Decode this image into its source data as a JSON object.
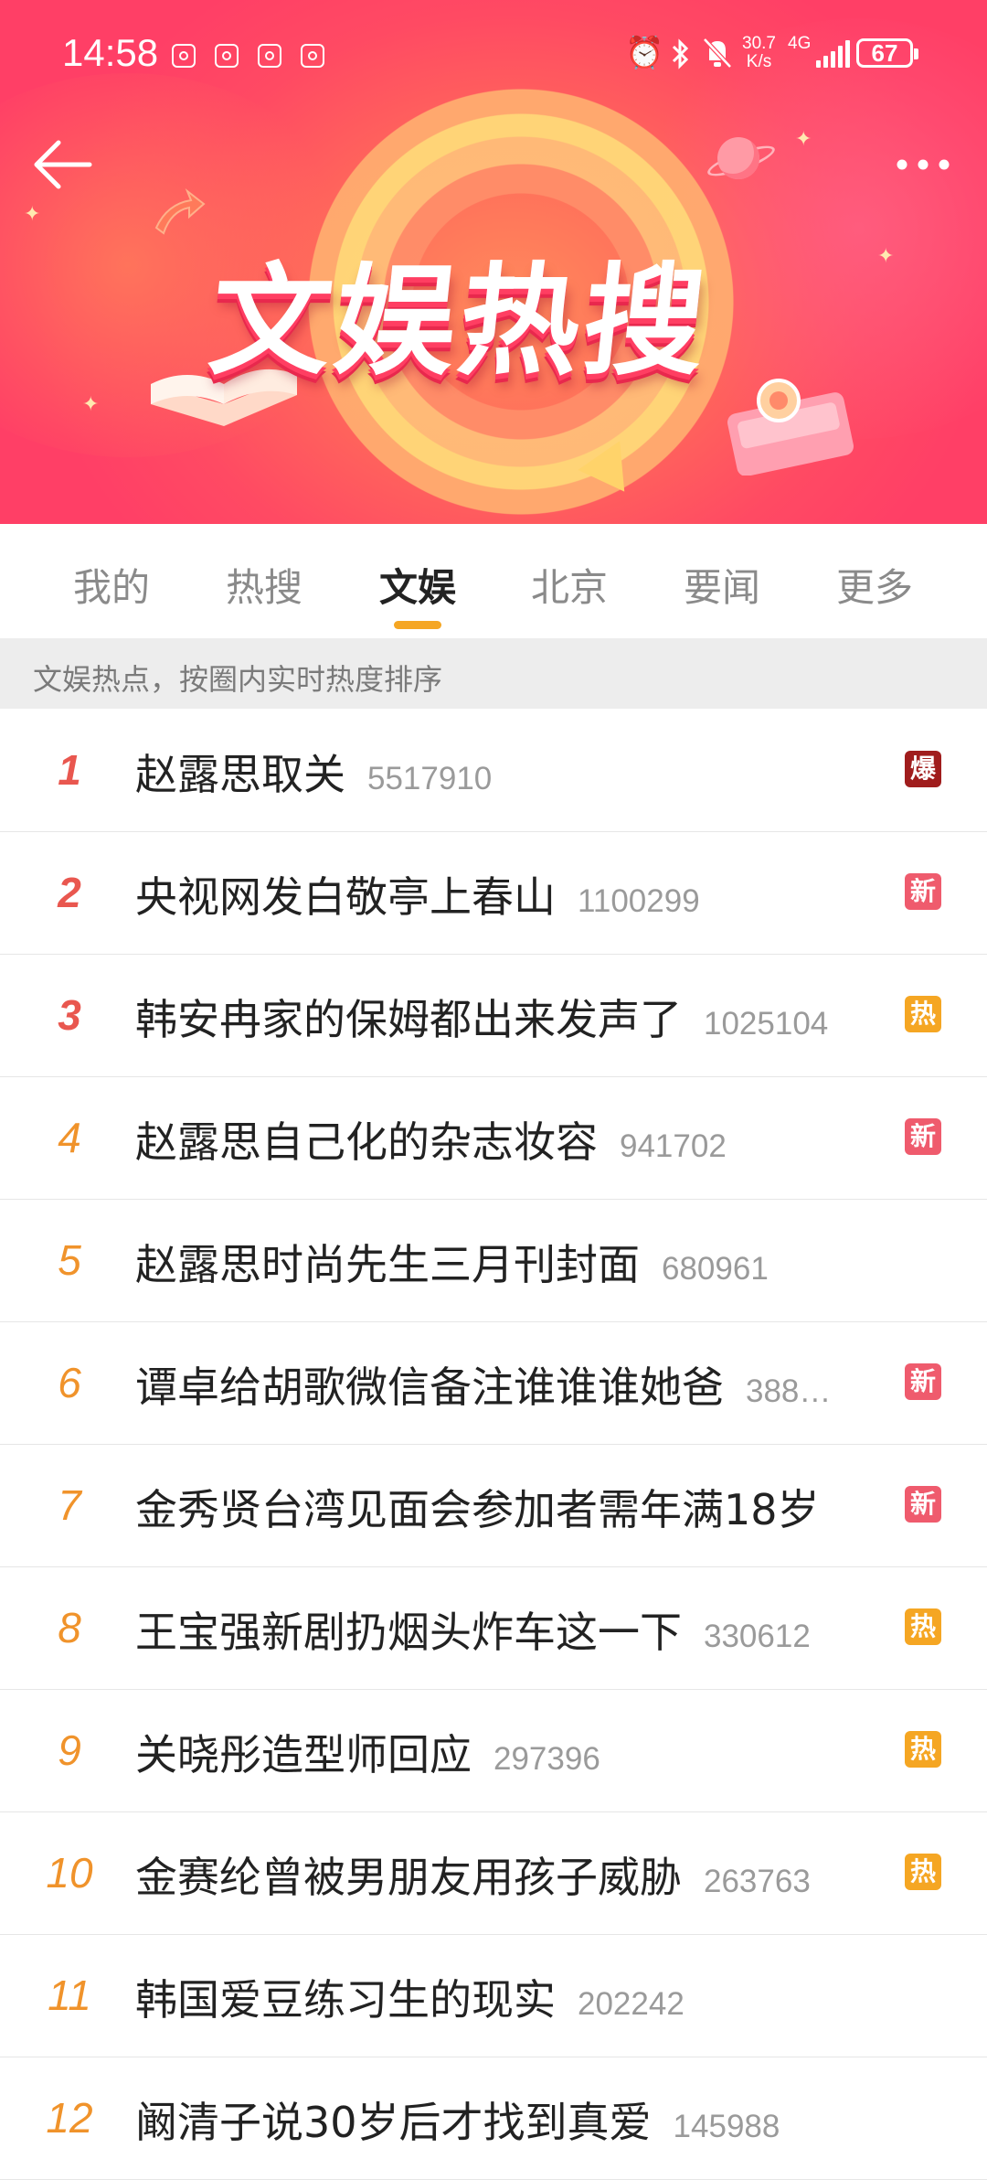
{
  "status_bar": {
    "time": "14:58",
    "net_speed_value": "30.7",
    "net_speed_unit": "K/s",
    "network_type": "4G",
    "battery": "67"
  },
  "banner": {
    "title": "文娱热搜"
  },
  "tabs": [
    {
      "label": "我的",
      "active": false
    },
    {
      "label": "热搜",
      "active": false
    },
    {
      "label": "文娱",
      "active": true
    },
    {
      "label": "北京",
      "active": false
    },
    {
      "label": "要闻",
      "active": false
    },
    {
      "label": "更多",
      "active": false
    }
  ],
  "subtitle": "文娱热点，按圈内实时热度排序",
  "colors": {
    "accent": "#f5a623",
    "rank_top": "#e9574f",
    "rank_other": "#f0932b",
    "badge_bao": "#a01d1d",
    "badge_xin": "#ef5b6d",
    "badge_re": "#f5a623"
  },
  "list": [
    {
      "rank": "1",
      "title": "赵露思取关",
      "count": "5517910",
      "badge": "爆"
    },
    {
      "rank": "2",
      "title": "央视网发白敬亭上春山",
      "count": "1100299",
      "badge": "新"
    },
    {
      "rank": "3",
      "title": "韩安冉家的保姆都出来发声了",
      "count": "1025104",
      "badge": "热"
    },
    {
      "rank": "4",
      "title": "赵露思自己化的杂志妆容",
      "count": "941702",
      "badge": "新"
    },
    {
      "rank": "5",
      "title": "赵露思时尚先生三月刊封面",
      "count": "680961",
      "badge": ""
    },
    {
      "rank": "6",
      "title": "谭卓给胡歌微信备注谁谁谁她爸",
      "count": "388…",
      "badge": "新"
    },
    {
      "rank": "7",
      "title": "金秀贤台湾见面会参加者需年满18岁",
      "count": "",
      "badge": "新"
    },
    {
      "rank": "8",
      "title": "王宝强新剧扔烟头炸车这一下",
      "count": "330612",
      "badge": "热"
    },
    {
      "rank": "9",
      "title": "关晓彤造型师回应",
      "count": "297396",
      "badge": "热"
    },
    {
      "rank": "10",
      "title": "金赛纶曾被男朋友用孩子威胁",
      "count": "263763",
      "badge": "热"
    },
    {
      "rank": "11",
      "title": "韩国爱豆练习生的现实",
      "count": "202242",
      "badge": ""
    },
    {
      "rank": "12",
      "title": "阚清子说30岁后才找到真爱",
      "count": "145988",
      "badge": ""
    }
  ]
}
